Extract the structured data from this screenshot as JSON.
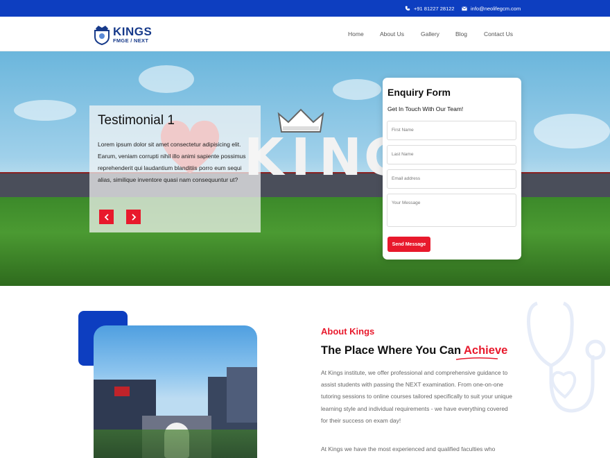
{
  "topbar": {
    "phone": "+91 81227 28122",
    "email": "info@neolifegcm.com",
    "icons": [
      "phone-icon",
      "mail-icon"
    ]
  },
  "header": {
    "logo_title": "KINGS",
    "logo_subtitle": "FMGE / NEXT",
    "nav": [
      "Home",
      "About Us",
      "Gallery",
      "Blog",
      "Contact Us"
    ]
  },
  "hero": {
    "testimonial_title": "Testimonial 1",
    "testimonial_text": "Lorem ipsum dolor sit amet consectetur adipisicing elit. Earum, veniam corrupti nihil illo animi sapiente possimus reprehenderit qui laudantium blanditiis porro eum sequi alias, similique inventore quasi nam consequuntur ut?",
    "sign_letters": [
      "K",
      "I",
      "N",
      "G"
    ]
  },
  "form": {
    "title": "Enquiry Form",
    "subtitle": "Get In Touch With Our Team!",
    "first_name_placeholder": "First Name",
    "last_name_placeholder": "Last Name",
    "email_placeholder": "Email address",
    "message_placeholder": "Your Message",
    "submit_label": "Send Message"
  },
  "about": {
    "label": "About Kings",
    "title_prefix": "The Place Where You Can ",
    "title_accent": "Achieve",
    "paragraph1": "At Kings institute, we offer professional and comprehensive guidance to assist students with passing the NEXT examination. From one-on-one tutoring sessions to online courses tailored specifically to suit your unique learning style and individual requirements - we have everything covered for their success on exam day!",
    "paragraph2": "At Kings we have the most experienced and qualified faculties who"
  },
  "colors": {
    "brand_blue": "#0d3ec0",
    "accent_red": "#e8192c"
  }
}
